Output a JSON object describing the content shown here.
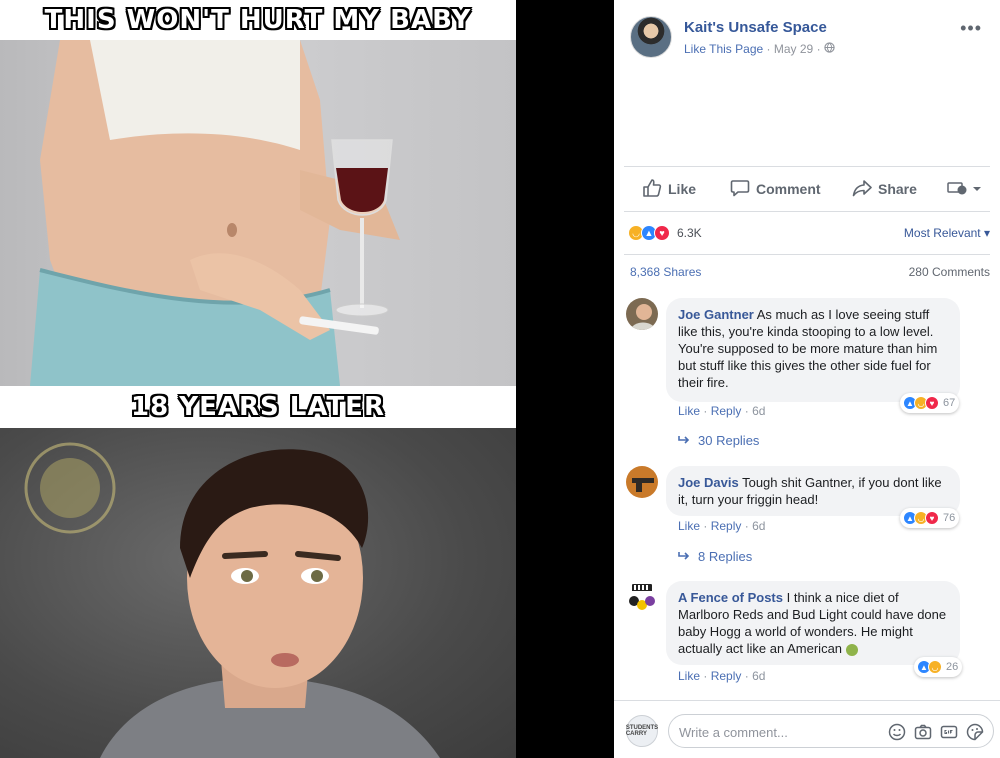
{
  "meme": {
    "top_caption": "THIS WON'T HURT MY BABY",
    "middle_caption": "18 YEARS LATER"
  },
  "post": {
    "page_name": "Kait's Unsafe Space",
    "like_page": "Like This Page",
    "separator": "·",
    "date": "May 29",
    "more": "•••"
  },
  "actions": {
    "like": "Like",
    "comment": "Comment",
    "share": "Share"
  },
  "reactions": {
    "count": "6.3K",
    "sort": "Most Relevant",
    "shares": "8,368 Shares",
    "comments": "280 Comments"
  },
  "comments": [
    {
      "author": "Joe Gantner",
      "text": "As much as I love seeing stuff like this, you're kinda stooping to a low level. You're supposed to be more mature than him but stuff like this gives the other side fuel for their fire.",
      "like": "Like",
      "reply": "Reply",
      "time": "6d",
      "reaction_count": "67",
      "replies": "30 Replies"
    },
    {
      "author": "Joe Davis",
      "text": "Tough shit Gantner, if you dont like it, turn your friggin head!",
      "like": "Like",
      "reply": "Reply",
      "time": "6d",
      "reaction_count": "76",
      "replies": "8 Replies"
    },
    {
      "author": "A Fence of Posts",
      "text": "I think a nice diet of Marlboro Reds and Bud Light could have done baby Hogg a world of wonders. He might actually act like an American",
      "like": "Like",
      "reply": "Reply",
      "time": "6d",
      "reaction_count": "26"
    }
  ],
  "composer": {
    "placeholder": "Write a comment...",
    "avatar_text": "STUDENTS CARRY"
  },
  "colors": {
    "link_blue": "#385898",
    "bubble_bg": "#f2f3f5",
    "like_blue": "#2d86ff",
    "haha_yellow": "#f7b125",
    "love_red": "#f0284a"
  }
}
